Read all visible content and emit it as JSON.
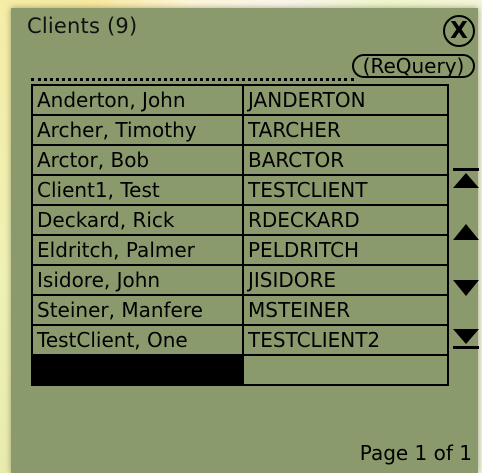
{
  "window": {
    "title": "Clients (9)",
    "close_label": "X",
    "requery_label": "(ReQuery)"
  },
  "clients": [
    {
      "name": "Anderton, John",
      "login": "JANDERTON"
    },
    {
      "name": "Archer, Timothy",
      "login": "TARCHER"
    },
    {
      "name": "Arctor, Bob",
      "login": "BARCTOR"
    },
    {
      "name": "Client1, Test",
      "login": "TESTCLIENT"
    },
    {
      "name": "Deckard, Rick",
      "login": "RDECKARD"
    },
    {
      "name": "Eldritch, Palmer",
      "login": "PELDRITCH"
    },
    {
      "name": "Isidore, John",
      "login": "JISIDORE"
    },
    {
      "name": "Steiner, Manfere",
      "login": "MSTEINER"
    },
    {
      "name": "TestClient, One",
      "login": "TESTCLIENT2"
    },
    {
      "name": "",
      "login": ""
    }
  ],
  "scroll_controls": [
    "scroll-top-icon",
    "scroll-up-icon",
    "scroll-down-icon",
    "scroll-bottom-icon"
  ],
  "footer": {
    "page_label": "Page 1 of 1"
  },
  "colors": {
    "screen_background": "#8a9a6c",
    "ink": "#000000"
  }
}
